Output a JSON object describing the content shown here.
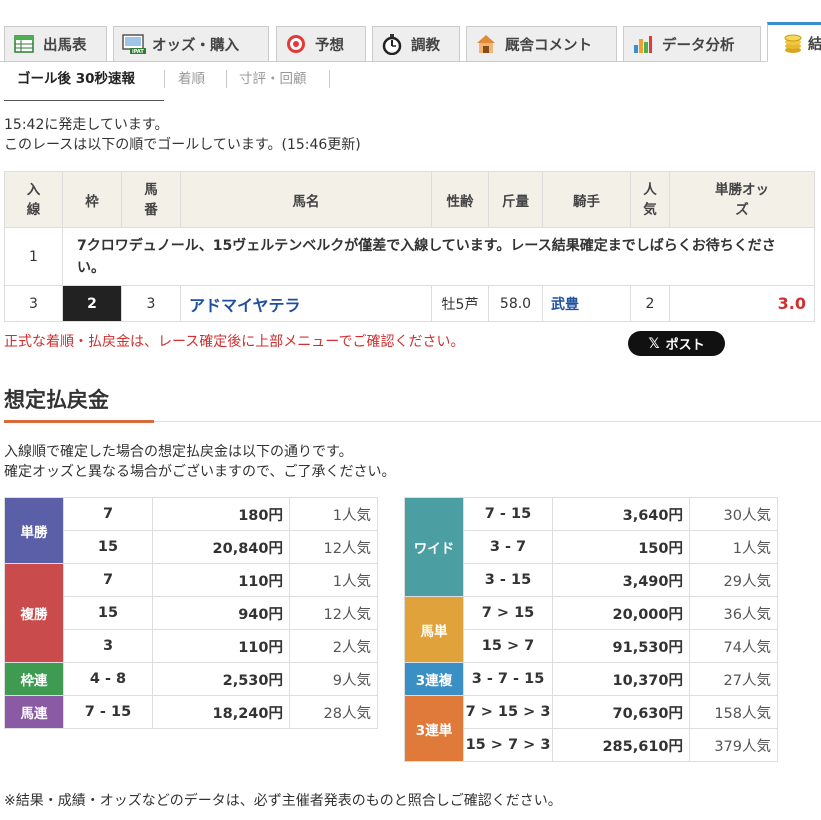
{
  "tabs": [
    {
      "label": "出馬表",
      "icon": "table-icon",
      "active": false
    },
    {
      "label": "オッズ・購入",
      "icon": "ipat-icon",
      "active": false
    },
    {
      "label": "予想",
      "icon": "target-icon",
      "active": false
    },
    {
      "label": "調教",
      "icon": "stopwatch-icon",
      "active": false
    },
    {
      "label": "厩舎コメント",
      "icon": "stable-icon",
      "active": false
    },
    {
      "label": "データ分析",
      "icon": "bar-chart-icon",
      "active": false
    },
    {
      "label": "結",
      "icon": "coins-icon",
      "active": true
    }
  ],
  "subtabs": [
    {
      "label": "ゴール後 30秒速報",
      "active": true
    },
    {
      "label": "着順",
      "active": false
    },
    {
      "label": "寸評・回顧",
      "active": false
    }
  ],
  "status": {
    "start": "15:42に発走しています。",
    "goal": "このレースは以下の順でゴールしています。(15:46更新)"
  },
  "result_table": {
    "headers": {
      "order": "入線",
      "frame": "枠",
      "number": "馬番",
      "name": "馬名",
      "sexage": "性齢",
      "weight": "斤量",
      "jockey": "騎手",
      "pop": "人気",
      "odds": "単勝オッズ"
    },
    "note_row": {
      "order": "1",
      "text": "7クロワデュノール、15ヴェルテンベルクが僅差で入線しています。レース結果確定までしばらくお待ちください。"
    },
    "row": {
      "order": "3",
      "frame": "2",
      "number": "3",
      "name": "アドマイヤテラ",
      "sexage": "牡5芦",
      "weight": "58.0",
      "jockey": "武豊",
      "pop": "2",
      "odds": "3.0"
    }
  },
  "confirm_note": "正式な着順・払戻金は、レース確定後に上部メニューでご確認ください。",
  "post_button": "ポスト",
  "payout": {
    "title": "想定払戻金",
    "desc1": "入線順で確定した場合の想定払戻金は以下の通りです。",
    "desc2": "確定オッズと異なる場合がございますので、ご了承ください。",
    "left": [
      {
        "label": "単勝",
        "color": "#5a5fa8",
        "rows": [
          {
            "num": "7",
            "yen": "180円",
            "pop": "1人気"
          },
          {
            "num": "15",
            "yen": "20,840円",
            "pop": "12人気"
          }
        ]
      },
      {
        "label": "複勝",
        "color": "#c94b4b",
        "rows": [
          {
            "num": "7",
            "yen": "110円",
            "pop": "1人気"
          },
          {
            "num": "15",
            "yen": "940円",
            "pop": "12人気"
          },
          {
            "num": "3",
            "yen": "110円",
            "pop": "2人気"
          }
        ]
      },
      {
        "label": "枠連",
        "color": "#3f9a52",
        "rows": [
          {
            "num": "4 - 8",
            "yen": "2,530円",
            "pop": "9人気"
          }
        ]
      },
      {
        "label": "馬連",
        "color": "#8a5aa5",
        "rows": [
          {
            "num": "7 - 15",
            "yen": "18,240円",
            "pop": "28人気"
          }
        ]
      }
    ],
    "right": [
      {
        "label": "ワイド",
        "color": "#4b9fa3",
        "rows": [
          {
            "num": "7 - 15",
            "yen": "3,640円",
            "pop": "30人気"
          },
          {
            "num": "3 - 7",
            "yen": "150円",
            "pop": "1人気"
          },
          {
            "num": "3 - 15",
            "yen": "3,490円",
            "pop": "29人気"
          }
        ]
      },
      {
        "label": "馬単",
        "color": "#e0a23a",
        "rows": [
          {
            "num": "7 > 15",
            "yen": "20,000円",
            "pop": "36人気"
          },
          {
            "num": "15 > 7",
            "yen": "91,530円",
            "pop": "74人気"
          }
        ]
      },
      {
        "label": "3連複",
        "color": "#3a8fc4",
        "rows": [
          {
            "num": "3 - 7 - 15",
            "yen": "10,370円",
            "pop": "27人気"
          }
        ]
      },
      {
        "label": "3連単",
        "color": "#e07a3a",
        "rows": [
          {
            "num": "7 > 15 > 3",
            "yen": "70,630円",
            "pop": "158人気"
          },
          {
            "num": "15 > 7 > 3",
            "yen": "285,610円",
            "pop": "379人気"
          }
        ]
      }
    ]
  },
  "footnote": "※結果・成績・オッズなどのデータは、必ず主催者発表のものと照合しご確認ください。"
}
